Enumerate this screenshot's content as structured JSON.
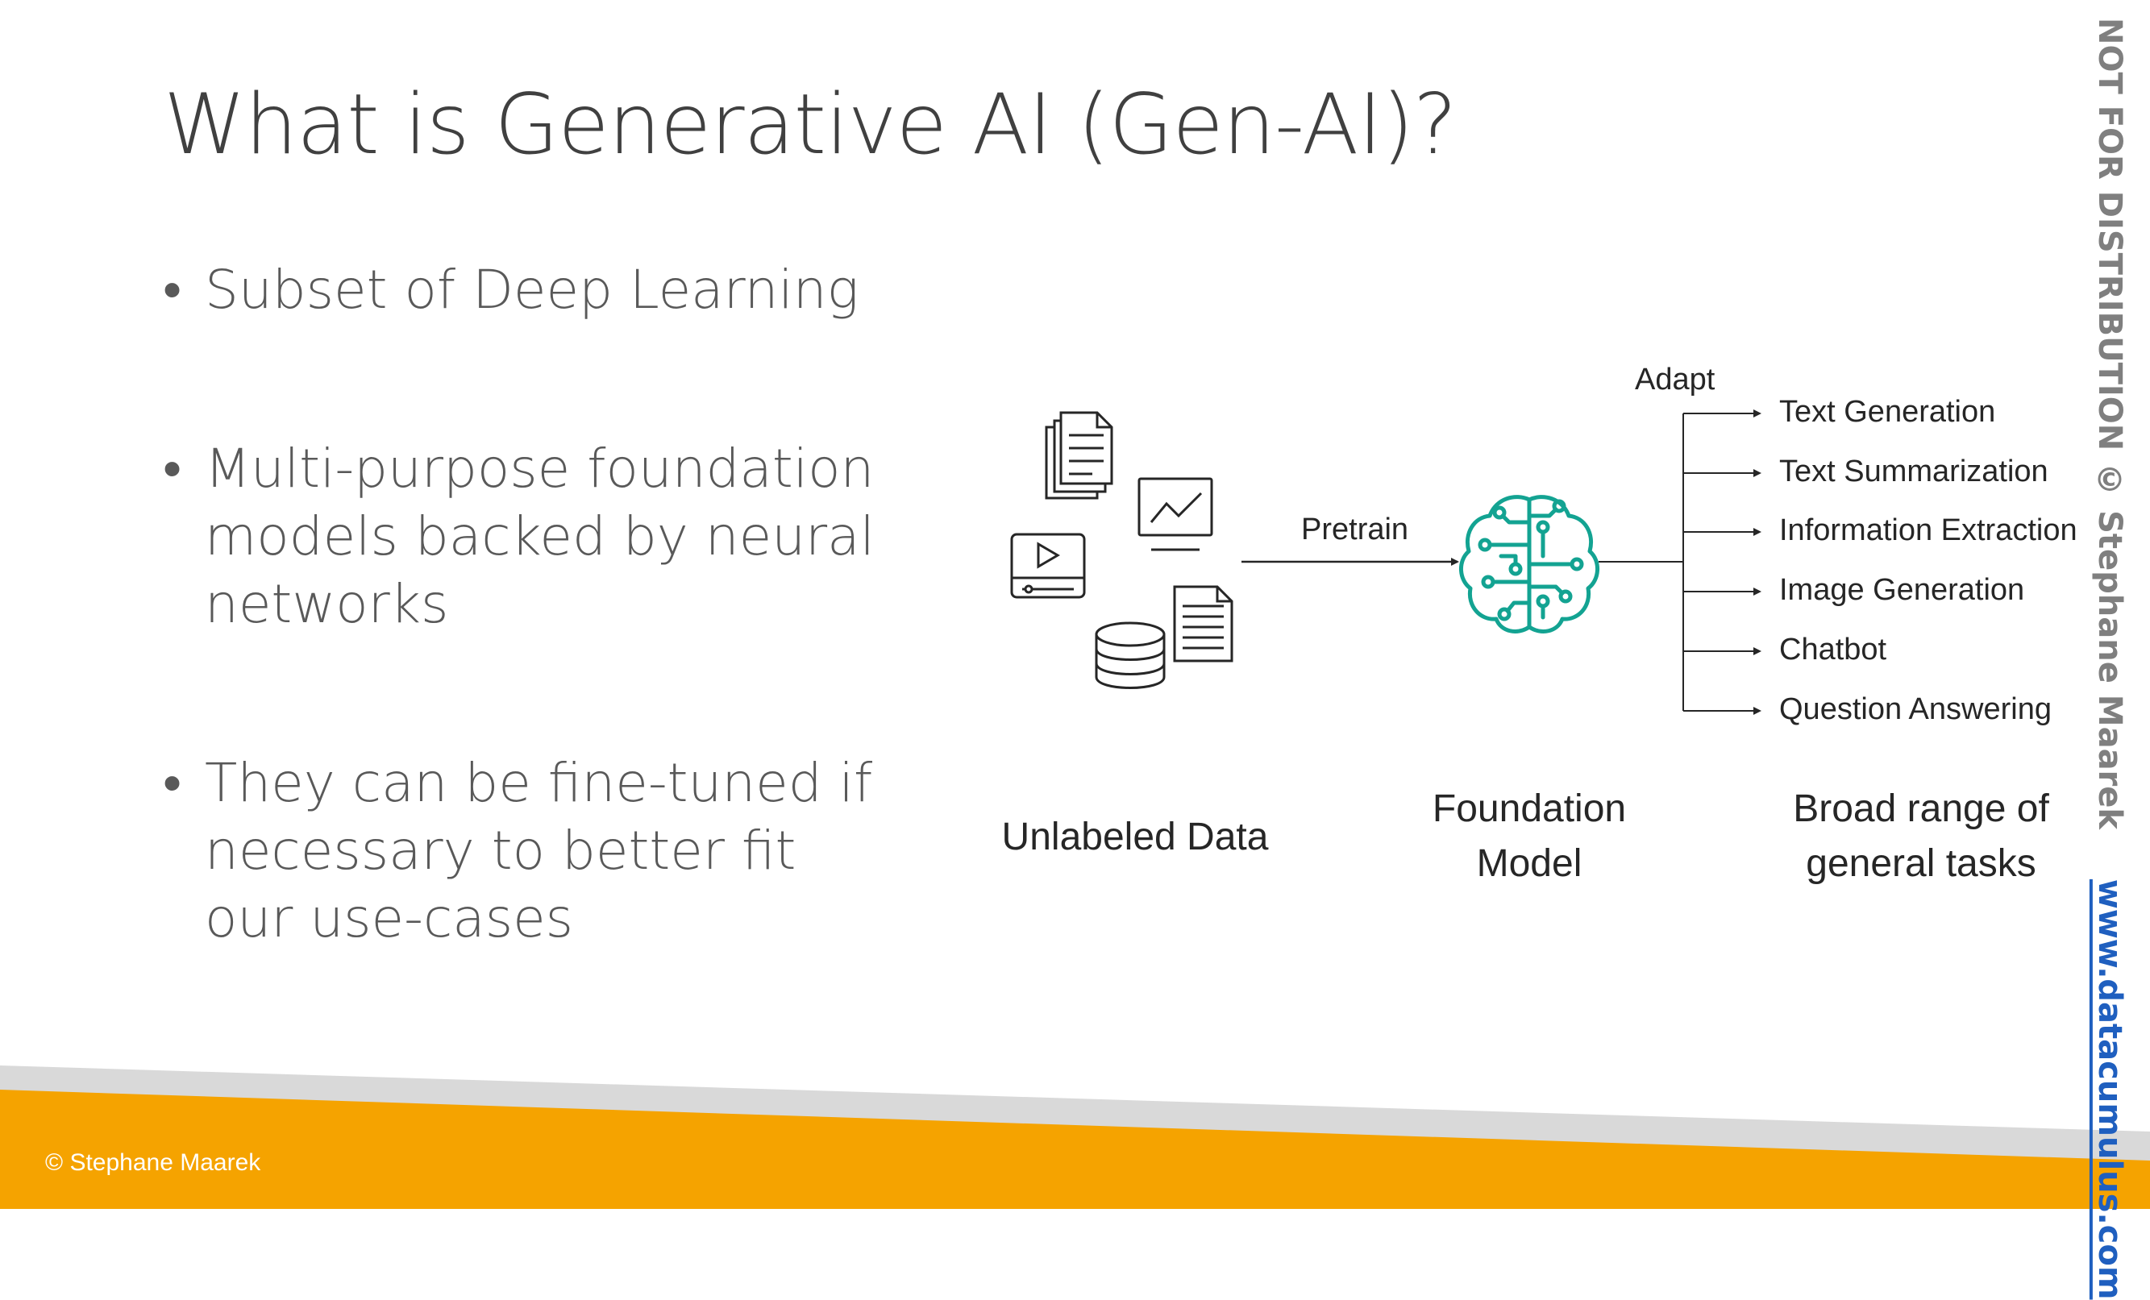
{
  "slide": {
    "title": "What is Generative AI (Gen-AI)?",
    "bullets": [
      "Subset of Deep Learning",
      "Multi-purpose foundation models backed by neural networks",
      "They can be fine-tuned if necessary to better fit our use-cases"
    ],
    "bullet_symbol": "•"
  },
  "diagram": {
    "pretrain_label": "Pretrain",
    "adapt_label": "Adapt",
    "tasks": [
      "Text Generation",
      "Text Summarization",
      "Information Extraction",
      "Image Generation",
      "Chatbot",
      "Question Answering"
    ],
    "captions": {
      "unlabeled_data": "Unlabeled Data",
      "foundation_model_line1": "Foundation",
      "foundation_model_line2": "Model",
      "tasks_line1": "Broad range of",
      "tasks_line2": "general tasks"
    },
    "icons": [
      "documents-icon",
      "chart-monitor-icon",
      "video-player-icon",
      "document-icon",
      "database-icon",
      "brain-circuit-icon"
    ]
  },
  "watermark": {
    "text": "NOT FOR DISTRIBUTION © Stephane Maarek",
    "site": "www.datacumulus.com"
  },
  "footer": {
    "copyright": "© Stephane Maarek"
  },
  "colors": {
    "accent_orange": "#f5a300",
    "band_gray": "#d9d9d9",
    "brain_teal": "#13a392",
    "link_blue": "#1f5fbf"
  }
}
